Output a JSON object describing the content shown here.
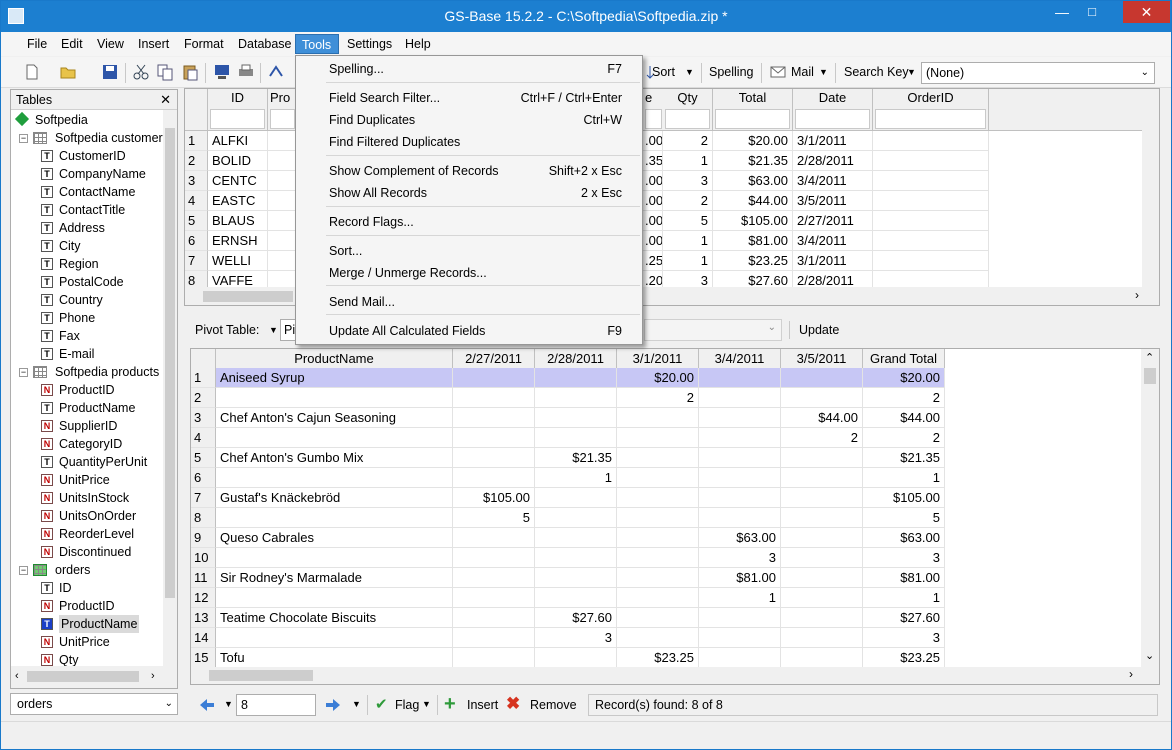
{
  "window": {
    "title": "GS-Base 15.2.2 - C:\\Softpedia\\Softpedia.zip *",
    "min": "—",
    "max": "□",
    "close": "✕"
  },
  "menubar": [
    "File",
    "Edit",
    "View",
    "Insert",
    "Format",
    "Database",
    "Tools",
    "Settings",
    "Help"
  ],
  "toolbar": {
    "sort": "Sort",
    "spelling": "Spelling",
    "mail": "Mail",
    "search_key": "Search Key",
    "search_key_value": "(None)"
  },
  "tools_menu": [
    {
      "label": "Spelling...",
      "shortcut": "F7"
    },
    {
      "label": "Field Search Filter...",
      "shortcut": "Ctrl+F / Ctrl+Enter"
    },
    {
      "label": "Find Duplicates",
      "shortcut": "Ctrl+W"
    },
    {
      "label": "Find Filtered Duplicates",
      "shortcut": ""
    },
    {
      "label": "Show Complement of Records",
      "shortcut": "Shift+2 x Esc"
    },
    {
      "label": "Show All Records",
      "shortcut": "2 x Esc"
    },
    {
      "label": "Record Flags...",
      "shortcut": ""
    },
    {
      "label": "Sort...",
      "shortcut": ""
    },
    {
      "label": "Merge / Unmerge Records...",
      "shortcut": ""
    },
    {
      "label": "Send Mail...",
      "shortcut": ""
    },
    {
      "label": "Update All Calculated Fields",
      "shortcut": "F9"
    }
  ],
  "tables_panel": {
    "title": "Tables",
    "close": "✕",
    "root": "Softpedia",
    "items": [
      {
        "label": "Softpedia customers",
        "kind": "table"
      },
      {
        "label": "CustomerID",
        "kind": "T"
      },
      {
        "label": "CompanyName",
        "kind": "T"
      },
      {
        "label": "ContactName",
        "kind": "T"
      },
      {
        "label": "ContactTitle",
        "kind": "T"
      },
      {
        "label": "Address",
        "kind": "T"
      },
      {
        "label": "City",
        "kind": "T"
      },
      {
        "label": "Region",
        "kind": "T"
      },
      {
        "label": "PostalCode",
        "kind": "T"
      },
      {
        "label": "Country",
        "kind": "T"
      },
      {
        "label": "Phone",
        "kind": "T"
      },
      {
        "label": "Fax",
        "kind": "T"
      },
      {
        "label": "E-mail",
        "kind": "T"
      },
      {
        "label": "Softpedia products",
        "kind": "table"
      },
      {
        "label": "ProductID",
        "kind": "N"
      },
      {
        "label": "ProductName",
        "kind": "T"
      },
      {
        "label": "SupplierID",
        "kind": "N"
      },
      {
        "label": "CategoryID",
        "kind": "N"
      },
      {
        "label": "QuantityPerUnit",
        "kind": "T"
      },
      {
        "label": "UnitPrice",
        "kind": "N"
      },
      {
        "label": "UnitsInStock",
        "kind": "N"
      },
      {
        "label": "UnitsOnOrder",
        "kind": "N"
      },
      {
        "label": "ReorderLevel",
        "kind": "N"
      },
      {
        "label": "Discontinued",
        "kind": "N"
      },
      {
        "label": "orders",
        "kind": "table-active"
      },
      {
        "label": "ID",
        "kind": "T"
      },
      {
        "label": "ProductID",
        "kind": "N"
      },
      {
        "label": "ProductName",
        "kind": "T-selected"
      },
      {
        "label": "UnitPrice",
        "kind": "N"
      },
      {
        "label": "Qty",
        "kind": "N"
      }
    ],
    "table_select": "orders"
  },
  "orders_grid": {
    "columns": [
      "ID",
      "Pro",
      "e",
      "Qty",
      "Total",
      "Date",
      "OrderID"
    ],
    "rows": [
      {
        "n": "1",
        "id": "ALFKI",
        "e": ".00",
        "qty": "2",
        "total": "$20.00",
        "date": "3/1/2011"
      },
      {
        "n": "2",
        "id": "BOLID",
        "e": ".35",
        "qty": "1",
        "total": "$21.35",
        "date": "2/28/2011"
      },
      {
        "n": "3",
        "id": "CENTC",
        "e": ".00",
        "qty": "3",
        "total": "$63.00",
        "date": "3/4/2011"
      },
      {
        "n": "4",
        "id": "EASTC",
        "e": ".00",
        "qty": "2",
        "total": "$44.00",
        "date": "3/5/2011"
      },
      {
        "n": "5",
        "id": "BLAUS",
        "e": ".00",
        "qty": "5",
        "total": "$105.00",
        "date": "2/27/2011"
      },
      {
        "n": "6",
        "id": "ERNSH",
        "e": ".00",
        "qty": "1",
        "total": "$81.00",
        "date": "3/4/2011"
      },
      {
        "n": "7",
        "id": "WELLI",
        "e": ".25",
        "qty": "1",
        "total": "$23.25",
        "date": "3/1/2011"
      },
      {
        "n": "8",
        "id": "VAFFE",
        "e": ".20",
        "qty": "3",
        "total": "$27.60",
        "date": "2/28/2011"
      }
    ]
  },
  "pivot": {
    "label": "Pivot Table:",
    "select_value": "Pi",
    "update": "Update",
    "columns": [
      "ProductName",
      "2/27/2011",
      "2/28/2011",
      "3/1/2011",
      "3/4/2011",
      "3/5/2011",
      "Grand Total"
    ],
    "rows": [
      [
        "1",
        "Aniseed Syrup",
        "",
        "",
        "$20.00",
        "",
        "",
        "$20.00"
      ],
      [
        "2",
        "",
        "",
        "",
        "2",
        "",
        "",
        "2"
      ],
      [
        "3",
        "Chef Anton's Cajun Seasoning",
        "",
        "",
        "",
        "",
        "$44.00",
        "$44.00"
      ],
      [
        "4",
        "",
        "",
        "",
        "",
        "",
        "2",
        "2"
      ],
      [
        "5",
        "Chef Anton's Gumbo Mix",
        "",
        "$21.35",
        "",
        "",
        "",
        "$21.35"
      ],
      [
        "6",
        "",
        "",
        "1",
        "",
        "",
        "",
        "1"
      ],
      [
        "7",
        "Gustaf's Knäckebröd",
        "$105.00",
        "",
        "",
        "",
        "",
        "$105.00"
      ],
      [
        "8",
        "",
        "5",
        "",
        "",
        "",
        "",
        "5"
      ],
      [
        "9",
        "Queso Cabrales",
        "",
        "",
        "",
        "$63.00",
        "",
        "$63.00"
      ],
      [
        "10",
        "",
        "",
        "",
        "",
        "3",
        "",
        "3"
      ],
      [
        "11",
        "Sir Rodney's Marmalade",
        "",
        "",
        "",
        "$81.00",
        "",
        "$81.00"
      ],
      [
        "12",
        "",
        "",
        "",
        "",
        "1",
        "",
        "1"
      ],
      [
        "13",
        "Teatime Chocolate Biscuits",
        "",
        "$27.60",
        "",
        "",
        "",
        "$27.60"
      ],
      [
        "14",
        "",
        "",
        "3",
        "",
        "",
        "",
        "3"
      ],
      [
        "15",
        "Tofu",
        "",
        "",
        "$23.25",
        "",
        "",
        "$23.25"
      ]
    ]
  },
  "bottom": {
    "record_value": "8",
    "flag": "Flag",
    "insert": "Insert",
    "remove": "Remove",
    "status": "Record(s) found: 8 of 8"
  }
}
